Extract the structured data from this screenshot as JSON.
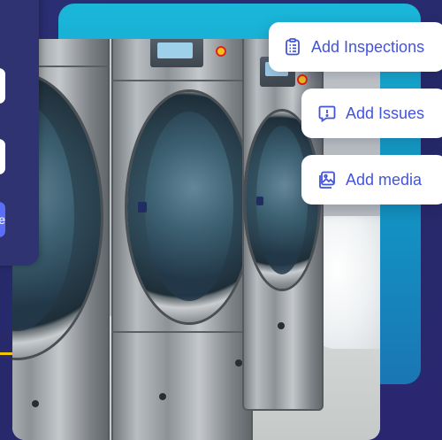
{
  "actions": {
    "add_inspections": "Add Inspections",
    "add_issues": "Add Issues",
    "add_media": "Add media"
  },
  "modal": {
    "close_glyph": "×",
    "button_partial": "e"
  },
  "colors": {
    "background": "#2b2e73",
    "accent_teal": "#1ab7d9",
    "pill_text": "#4454d8",
    "modal_button": "#5b6ef7",
    "highlight_yellow": "#f5c400"
  },
  "icons": {
    "inspections": "clipboard-list-icon",
    "issues": "alert-speech-icon",
    "media": "image-gallery-icon"
  }
}
